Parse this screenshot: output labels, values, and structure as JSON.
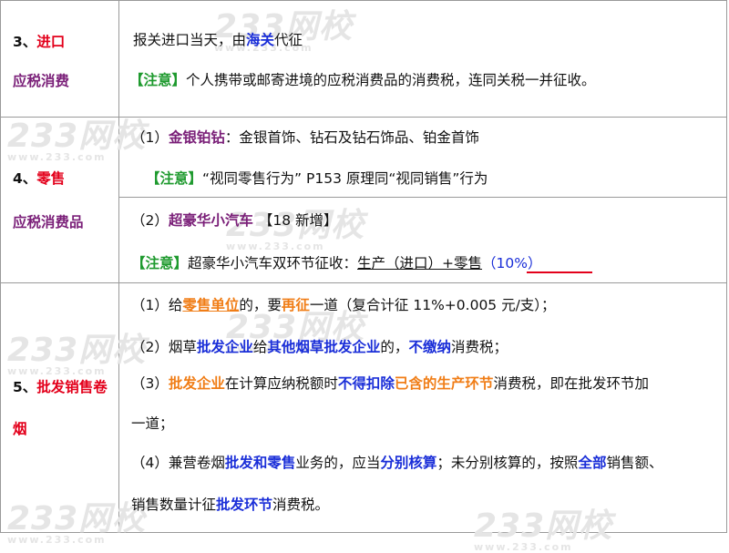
{
  "watermark": {
    "logo_text": "233网校",
    "url_text": "www.233.com"
  },
  "rows": {
    "r3": {
      "num": "3、",
      "label_a": "进口",
      "label_b": "应税消费",
      "l1_a": "报关进口当天，由",
      "l1_b": "海关",
      "l1_c": "代征",
      "note_tag": "【注意】",
      "l2": "个人携带或邮寄进境的应税消费品的消费税，连同关税一并征收。"
    },
    "r4": {
      "num": "4、",
      "label_a": "零售",
      "label_b": "应税消费品",
      "s1_a": "（1）",
      "s1_b": "金银铂钻",
      "s1_c": "：金银首饰、钻石及钻石饰品、铂金首饰",
      "s1_note_tag": "【注意】",
      "s1_note": "“视同零售行为”  P153 原理同“视同销售”行为",
      "s2_a": "（2）",
      "s2_b": "超豪华小汽车",
      "s2_c": "【18 新增】",
      "s2_note_tag": "【注意】",
      "s2_note_a": "超豪华小汽车双环节征收：",
      "s2_note_b": "生产（进口）+零售",
      "s2_note_c": "（10%）"
    },
    "r5": {
      "num": "5、",
      "label_a": "批发销售卷",
      "label_b": "烟",
      "p1_a": "（1）给",
      "p1_b": "零售单位",
      "p1_c": "的，要",
      "p1_d": "再征",
      "p1_e": "一道（复合计征 11%+0.005 元/支）；",
      "p2_a": "（2）烟草",
      "p2_b": "批发企业",
      "p2_c": "给",
      "p2_d": "其他烟草批发企业",
      "p2_e": "的，",
      "p2_f": "不缴纳",
      "p2_g": "消费税；",
      "p3_a": "（3）",
      "p3_b": "批发企业",
      "p3_c": "在计算应纳税额时",
      "p3_d": "不得扣除",
      "p3_e": "已含的生产环节",
      "p3_f": "消费税，即在批发环节加",
      "p3_g": "一道；",
      "p4_a": "（4）兼营卷烟",
      "p4_b": "批发和零售",
      "p4_c": "业务的，应当",
      "p4_d": "分别核算",
      "p4_e": "；未分别核算的，按照",
      "p4_f": "全部",
      "p4_g": "销售额、",
      "p5_a": "销售数量计征",
      "p5_b": "批发环节",
      "p5_c": "消费税。"
    }
  }
}
